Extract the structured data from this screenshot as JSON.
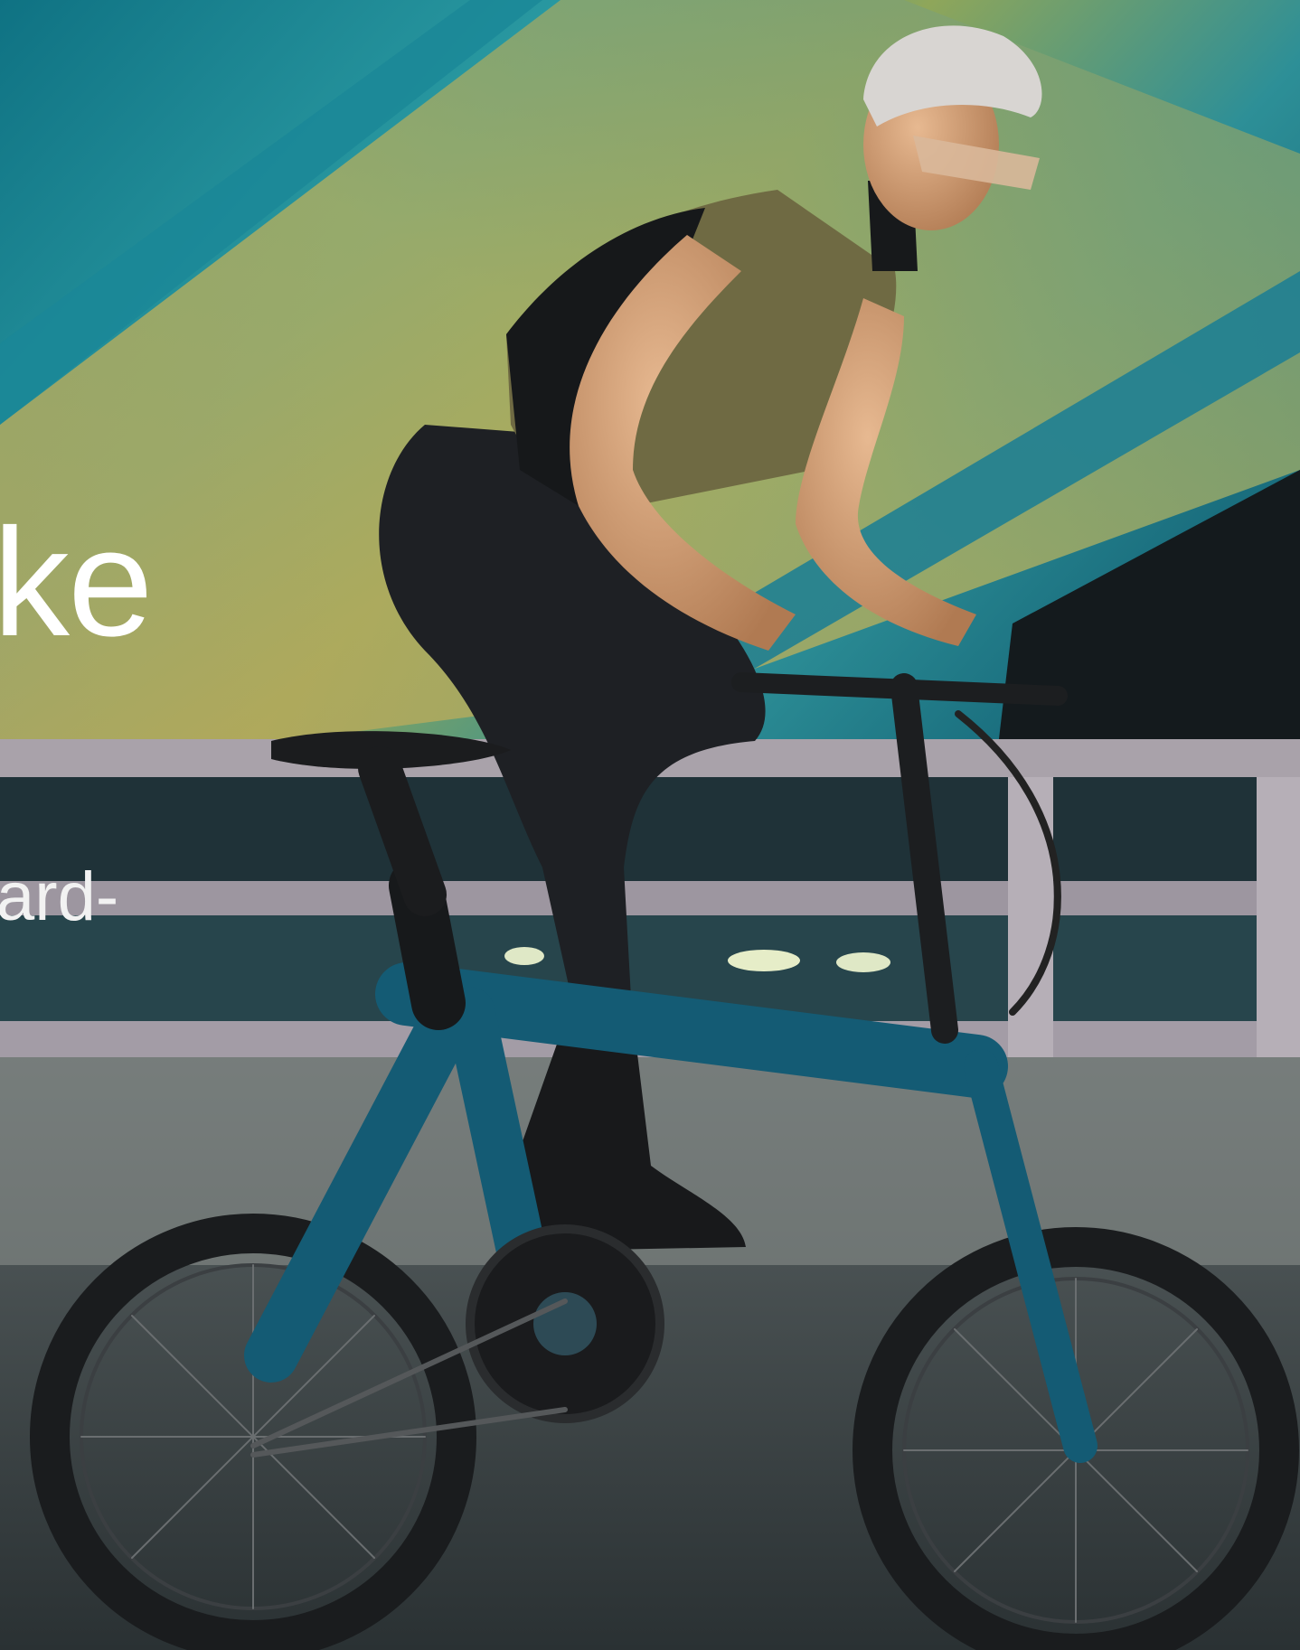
{
  "hero": {
    "title_fragment": "ke",
    "subtitle_fragment": "ard-"
  },
  "colors": {
    "teal_wall": "#1c8c98",
    "olive_wall": "#a8a657",
    "bike_frame": "#145b74",
    "jersey_olive": "#6f6a43",
    "tights": "#1e2024",
    "railing": "#a9a2aa",
    "road": "#3e4648"
  }
}
